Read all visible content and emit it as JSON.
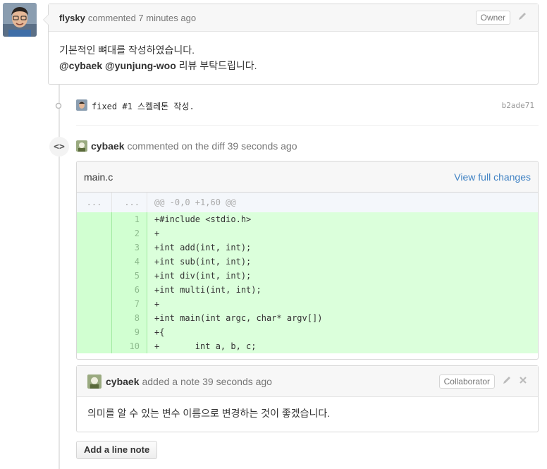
{
  "comment": {
    "author": "flysky",
    "meta": "commented 7 minutes ago",
    "badge": "Owner",
    "body_line1": "기본적인 뼈대를 작성하였습니다.",
    "mention1": "@cybaek",
    "mention2": "@yunjung-woo",
    "body_line2_rest": " 리뷰 부탁드립니다."
  },
  "commit": {
    "message": "fixed #1 스켈레톤 작성.",
    "sha": "b2ade71"
  },
  "diff_comment": {
    "author": "cybaek",
    "meta": "commented on the diff 39 seconds ago",
    "file_name": "main.c",
    "view_link": "View full changes",
    "hunk": {
      "ln1": "...",
      "ln2": "...",
      "text": "@@ -0,0 +1,60 @@"
    },
    "lines": [
      {
        "num": "1",
        "text": "+#include <stdio.h>"
      },
      {
        "num": "2",
        "text": "+"
      },
      {
        "num": "3",
        "text": "+int add(int, int);"
      },
      {
        "num": "4",
        "text": "+int sub(int, int);"
      },
      {
        "num": "5",
        "text": "+int div(int, int);"
      },
      {
        "num": "6",
        "text": "+int multi(int, int);"
      },
      {
        "num": "7",
        "text": "+"
      },
      {
        "num": "8",
        "text": "+int main(int argc, char* argv[])"
      },
      {
        "num": "9",
        "text": "+{"
      },
      {
        "num": "10",
        "text": "+       int a, b, c;"
      }
    ]
  },
  "note": {
    "author": "cybaek",
    "meta": "added a note 39 seconds ago",
    "badge": "Collaborator",
    "body": "의미를 알 수 있는 변수 이름으로 변경하는 것이 좋겠습니다."
  },
  "add_line_note_label": "Add a line note",
  "icons": {
    "edit": "pencil-icon",
    "close": "close-icon",
    "code": "code-icon",
    "commit": "commit-icon"
  },
  "colors": {
    "link": "#4183c4",
    "added_bg": "#dbffdb",
    "added_gutter": "#d1ffd1"
  }
}
